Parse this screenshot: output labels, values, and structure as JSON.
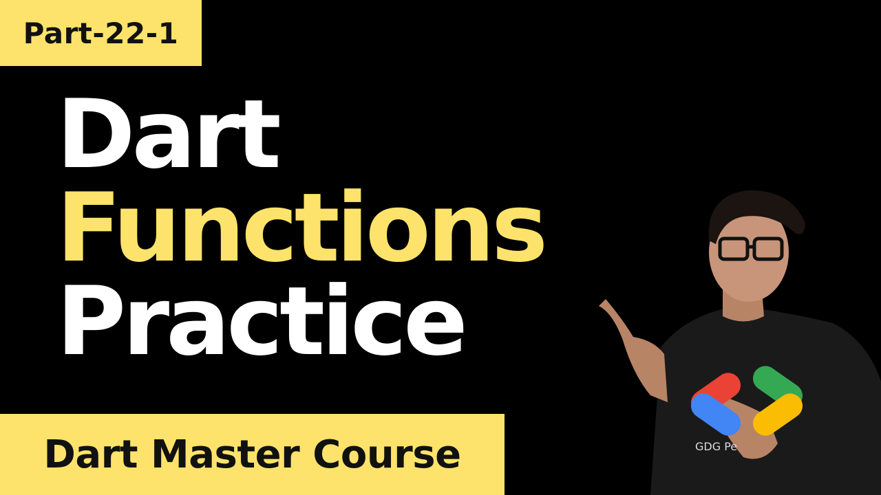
{
  "badge": {
    "label": "Part-22-1"
  },
  "title": {
    "line1": "Dart",
    "line2": "Functions",
    "line3": "Practice"
  },
  "banner": {
    "label": "Dart Master Course"
  },
  "presenter": {
    "shirt_text": "GDG Pe"
  },
  "colors": {
    "background": "#000000",
    "accent_yellow": "#fde36b",
    "title_white": "#ffffff",
    "logo_blue": "#4285f4",
    "logo_red": "#ea4335",
    "logo_green": "#34a853",
    "logo_yellow": "#fbbc04"
  }
}
